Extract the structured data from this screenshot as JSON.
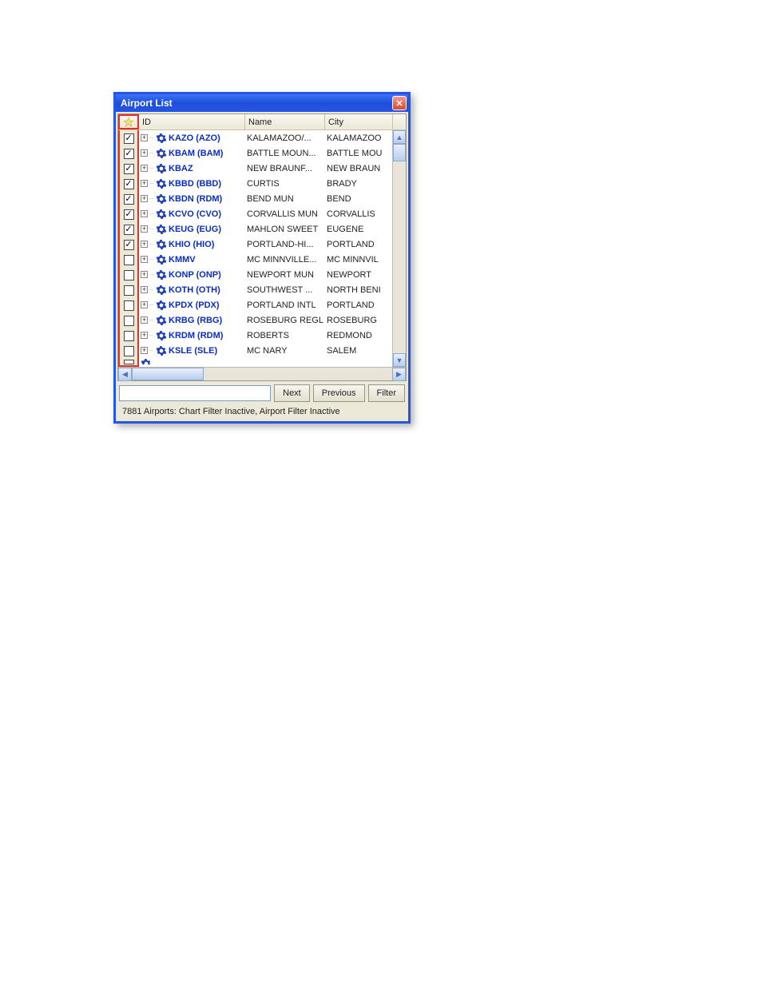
{
  "window": {
    "title": "Airport List",
    "close_glyph": "✕"
  },
  "columns": {
    "id": "ID",
    "name": "Name",
    "city": "City"
  },
  "rows": [
    {
      "checked": true,
      "id": "KAZO (AZO)",
      "name": "KALAMAZOO/...",
      "city": "KALAMAZOO"
    },
    {
      "checked": true,
      "id": "KBAM (BAM)",
      "name": "BATTLE MOUN...",
      "city": "BATTLE MOU"
    },
    {
      "checked": true,
      "id": "KBAZ",
      "name": "NEW BRAUNF...",
      "city": "NEW BRAUN"
    },
    {
      "checked": true,
      "id": "KBBD (BBD)",
      "name": "CURTIS",
      "city": "BRADY"
    },
    {
      "checked": true,
      "id": "KBDN (RDM)",
      "name": "BEND MUN",
      "city": "BEND"
    },
    {
      "checked": true,
      "id": "KCVO (CVO)",
      "name": "CORVALLIS MUN",
      "city": "CORVALLIS"
    },
    {
      "checked": true,
      "id": "KEUG (EUG)",
      "name": "MAHLON SWEET",
      "city": "EUGENE"
    },
    {
      "checked": true,
      "id": "KHIO (HIO)",
      "name": "PORTLAND-HI...",
      "city": "PORTLAND"
    },
    {
      "checked": false,
      "id": "KMMV",
      "name": "MC MINNVILLE...",
      "city": "MC MINNVIL"
    },
    {
      "checked": false,
      "id": "KONP (ONP)",
      "name": "NEWPORT MUN",
      "city": "NEWPORT"
    },
    {
      "checked": false,
      "id": "KOTH (OTH)",
      "name": "SOUTHWEST ...",
      "city": "NORTH BENI"
    },
    {
      "checked": false,
      "id": "KPDX (PDX)",
      "name": "PORTLAND INTL",
      "city": "PORTLAND"
    },
    {
      "checked": false,
      "id": "KRBG (RBG)",
      "name": "ROSEBURG REGL",
      "city": "ROSEBURG"
    },
    {
      "checked": false,
      "id": "KRDM (RDM)",
      "name": "ROBERTS",
      "city": "REDMOND"
    },
    {
      "checked": false,
      "id": "KSLE (SLE)",
      "name": "MC NARY",
      "city": "SALEM"
    }
  ],
  "buttons": {
    "next": "Next",
    "previous": "Previous",
    "filter": "Filter"
  },
  "search": {
    "value": "",
    "placeholder": ""
  },
  "status": "7881 Airports: Chart Filter Inactive, Airport Filter Inactive",
  "glyphs": {
    "up": "▲",
    "down": "▼",
    "left": "◀",
    "right": "▶",
    "plus": "+",
    "check": "✓"
  }
}
